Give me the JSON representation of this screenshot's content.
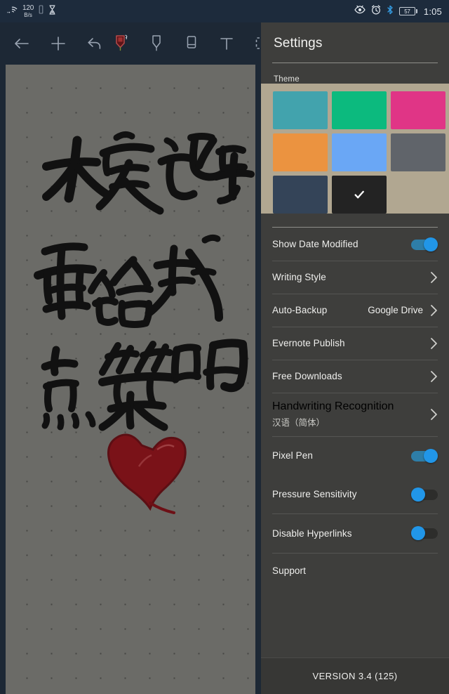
{
  "status_bar": {
    "wifi_icon": "wifi-icon",
    "network_speed_value": "120",
    "network_speed_unit": "B/s",
    "sim_icon": "sim-card-icon",
    "hourglass_icon": "hourglass-icon",
    "eye_icon": "eye-icon",
    "alarm_icon": "alarm-clock-icon",
    "bluetooth_icon": "bluetooth-icon",
    "battery_level": "57",
    "time": "1:05"
  },
  "toolbar": {
    "back_label": "back-arrow-icon",
    "add_label": "plus-icon",
    "undo_label": "undo-icon",
    "pen_label": "pen-icon",
    "highlighter_label": "highlighter-icon",
    "eraser_label": "eraser-icon",
    "text_label": "T",
    "select_label": "selection-box-icon"
  },
  "canvas": {
    "note_lines": [
      "大家记得",
      "要给我",
      "点赞哟"
    ],
    "heart_color": "#7a1218",
    "ink_color": "#111111",
    "page_color": "#6b6b67"
  },
  "panel": {
    "title": "Settings",
    "theme_section_label": "Theme",
    "themes": [
      {
        "name": "sand",
        "color": "#b1a791",
        "selected": false
      },
      {
        "name": "teal",
        "color": "#42a3ad",
        "selected": false
      },
      {
        "name": "green",
        "color": "#0cba7e",
        "selected": false
      },
      {
        "name": "pink",
        "color": "#e03586",
        "selected": false
      },
      {
        "name": "orange",
        "color": "#eb9340",
        "selected": false
      },
      {
        "name": "blue",
        "color": "#6aa7f5",
        "selected": false
      },
      {
        "name": "gray",
        "color": "#60646a",
        "selected": false
      },
      {
        "name": "navy",
        "color": "#344458",
        "selected": true
      },
      {
        "name": "black",
        "color": "#232323",
        "selected": false
      }
    ],
    "rows": [
      {
        "label": "Show Date Modified",
        "type": "toggle",
        "state": "on",
        "sub": "",
        "value": ""
      },
      {
        "label": "Writing Style",
        "type": "chevron",
        "state": "",
        "sub": "",
        "value": ""
      },
      {
        "label": "Auto-Backup",
        "type": "chevron",
        "state": "",
        "sub": "",
        "value": "Google Drive"
      },
      {
        "label": "Evernote Publish",
        "type": "chevron",
        "state": "",
        "sub": "",
        "value": ""
      },
      {
        "label": "Free Downloads",
        "type": "chevron",
        "state": "",
        "sub": "",
        "value": ""
      },
      {
        "label": "Handwriting Recognition",
        "type": "chevron",
        "state": "",
        "sub": "汉语（简体）",
        "value": ""
      },
      {
        "label": "Pixel Pen",
        "type": "toggle",
        "state": "on",
        "sub": "",
        "value": ""
      },
      {
        "label": "Pressure Sensitivity",
        "type": "toggle",
        "state": "off",
        "sub": "",
        "value": ""
      },
      {
        "label": "Disable Hyperlinks",
        "type": "toggle",
        "state": "off",
        "sub": "",
        "value": ""
      },
      {
        "label": "Support",
        "type": "plain",
        "state": "",
        "sub": "",
        "value": ""
      }
    ],
    "version": "VERSION 3.4 (125)"
  }
}
